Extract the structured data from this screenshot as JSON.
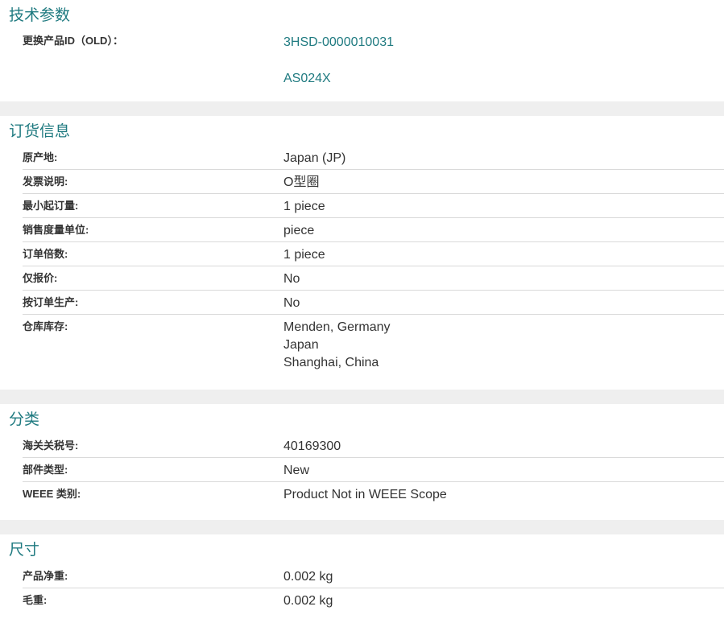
{
  "sections": {
    "tech": {
      "title": "技术参数",
      "label": "更换产品ID（OLD）：",
      "values": [
        "3HSD-0000010031",
        "AS024X"
      ]
    },
    "ordering": {
      "title": "订货信息",
      "rows": [
        {
          "label": "原产地:",
          "value": "Japan (JP)"
        },
        {
          "label": "发票说明:",
          "value": "O型圈"
        },
        {
          "label": "最小起订量:",
          "value": "1 piece"
        },
        {
          "label": "销售度量单位:",
          "value": "piece"
        },
        {
          "label": "订单倍数:",
          "value": "1 piece"
        },
        {
          "label": "仅报价:",
          "value": "No"
        },
        {
          "label": "按订单生产:",
          "value": "No"
        },
        {
          "label": "仓库库存:",
          "values": [
            "Menden, Germany",
            "Japan",
            "Shanghai, China"
          ]
        }
      ]
    },
    "classification": {
      "title": "分类",
      "rows": [
        {
          "label": "海关关税号:",
          "value": "40169300"
        },
        {
          "label": "部件类型:",
          "value": "New"
        },
        {
          "label": "WEEE 类别:",
          "value": "Product Not in WEEE Scope"
        }
      ]
    },
    "dimensions": {
      "title": "尺寸",
      "rows": [
        {
          "label": "产品净重:",
          "value": "0.002 kg"
        },
        {
          "label": "毛重:",
          "value": "0.002 kg"
        }
      ]
    }
  }
}
